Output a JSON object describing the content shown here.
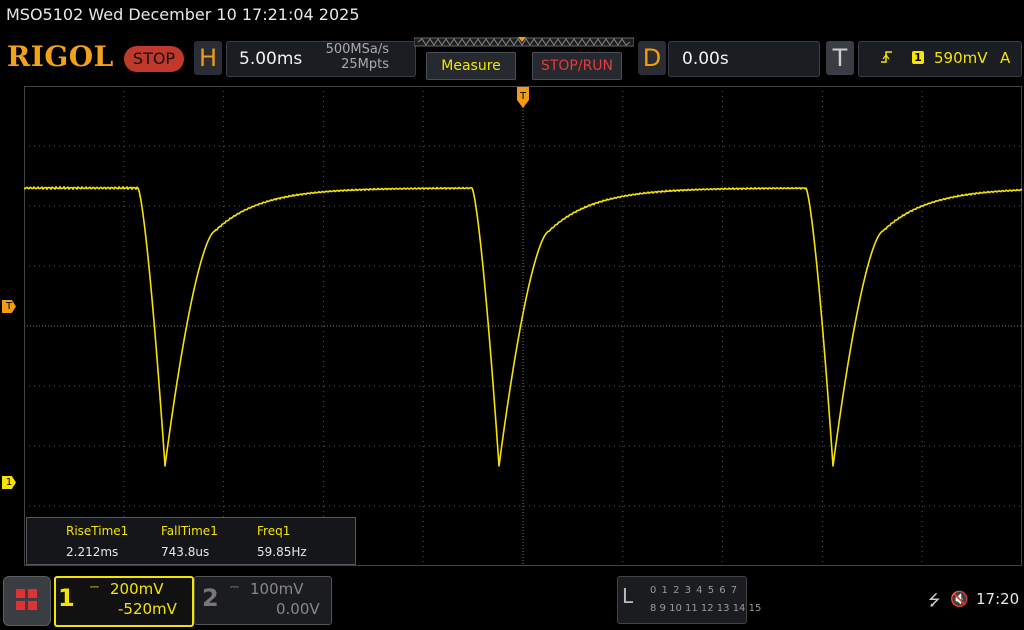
{
  "title_line": "MSO5102  Wed December 10 17:21:04 2025",
  "logo": "RIGOL",
  "run_state": "STOP",
  "horizontal": {
    "tag": "H",
    "timebase": "5.00ms",
    "sample_rate": "500MSa/s",
    "memory_depth": "25Mpts"
  },
  "buttons": {
    "measure": "Measure",
    "stop_run": "STOP/RUN"
  },
  "delay": {
    "tag": "D",
    "value": "0.00s"
  },
  "trigger": {
    "tag": "T",
    "source": "1",
    "level": "590mV",
    "mode": "A",
    "marker": "T"
  },
  "channel1": {
    "number": "1",
    "scale": "200mV",
    "offset": "-520mV",
    "marker": "1"
  },
  "channel2": {
    "number": "2",
    "scale": "100mV",
    "offset": "0.00V"
  },
  "measurements": {
    "headers": [
      "RiseTime1",
      "FallTime1",
      "Freq1"
    ],
    "values": [
      "2.212ms",
      "743.8us",
      "59.85Hz"
    ]
  },
  "logic_analyzer": {
    "tag": "L",
    "row1": "0 1 2 3  4 5 6 7",
    "row2": "8 9 10 11 12 13 14 15"
  },
  "status": {
    "time": "17:20",
    "usb_icon": "usb-icon",
    "sound_icon": "speaker-muted-icon"
  },
  "colors": {
    "ch1": "#f6e400",
    "accent": "#f39c12",
    "stop": "#c0392b",
    "grid": "#555555"
  }
}
